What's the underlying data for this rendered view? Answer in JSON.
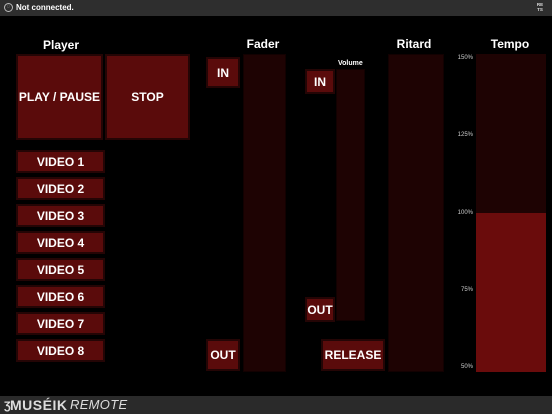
{
  "topbar": {
    "status_icon": "circle-status-icon",
    "status_text": "Not connected.",
    "corner_line1": "RE",
    "corner_line2": "TS"
  },
  "headers": {
    "player": "Player",
    "fader": "Fader",
    "ritard": "Ritard",
    "tempo": "Tempo"
  },
  "player": {
    "play_pause": "PLAY / PAUSE",
    "stop": "STOP",
    "videos": [
      "VIDEO 1",
      "VIDEO 2",
      "VIDEO 3",
      "VIDEO 4",
      "VIDEO 5",
      "VIDEO 6",
      "VIDEO 7",
      "VIDEO 8"
    ]
  },
  "fader": {
    "in": "IN",
    "out": "OUT"
  },
  "ritard": {
    "volume_label": "Volume",
    "in": "IN",
    "out": "OUT",
    "release": "RELEASE"
  },
  "tempo": {
    "ticks": [
      "150%",
      "125%",
      "100%",
      "75%",
      "50%"
    ],
    "value_percent": 100
  },
  "branding": {
    "mark": "Ʒ",
    "name": "MUSÉIK",
    "suffix": "REMOTE"
  },
  "colors": {
    "button": "#5a0b0b",
    "track": "#1e0303",
    "tempo_fill": "#6a0c0c"
  }
}
